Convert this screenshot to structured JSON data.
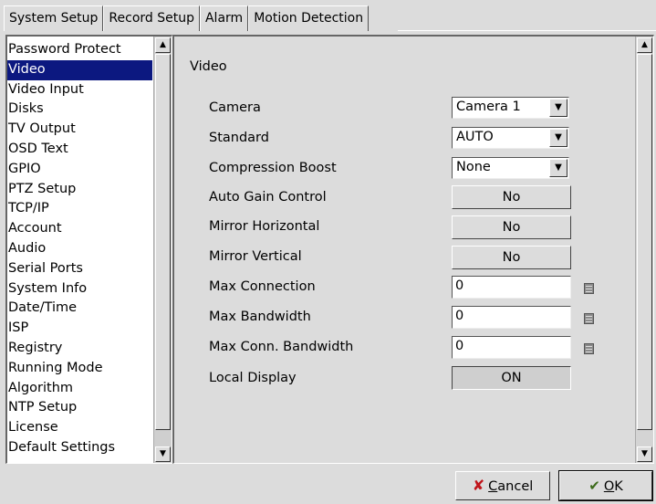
{
  "tabs": [
    "System Setup",
    "Record Setup",
    "Alarm",
    "Motion Detection"
  ],
  "sidebar": {
    "items": [
      "Password Protect",
      "Video",
      "Video Input",
      "Disks",
      "TV Output",
      "OSD Text",
      "GPIO",
      "PTZ Setup",
      "TCP/IP",
      "Account",
      "Audio",
      "Serial Ports",
      "System Info",
      "Date/Time",
      "ISP",
      "Registry",
      "Running Mode",
      "Algorithm",
      "NTP Setup",
      "License",
      "Default Settings"
    ],
    "selected": "Video"
  },
  "panel": {
    "title": "Video",
    "camera": {
      "label": "Camera",
      "value": "Camera 1"
    },
    "standard": {
      "label": "Standard",
      "value": "AUTO"
    },
    "compression_boost": {
      "label": "Compression Boost",
      "value": "None"
    },
    "auto_gain": {
      "label": "Auto Gain Control",
      "value": "No"
    },
    "mirror_h": {
      "label": "Mirror Horizontal",
      "value": "No"
    },
    "mirror_v": {
      "label": "Mirror Vertical",
      "value": "No"
    },
    "max_connection": {
      "label": "Max Connection",
      "value": "0"
    },
    "max_bandwidth": {
      "label": "Max Bandwidth",
      "value": "0"
    },
    "max_conn_bandwidth": {
      "label": "Max Conn. Bandwidth",
      "value": "0"
    },
    "local_display": {
      "label": "Local Display",
      "value": "ON"
    }
  },
  "footer": {
    "cancel_prefix": "",
    "cancel_mnemonic": "C",
    "cancel_rest": "ancel",
    "ok_mnemonic": "O",
    "ok_rest": "K"
  },
  "colors": {
    "selection": "#0c1880",
    "cancel_icon": "#c0151b",
    "ok_icon": "#3c6a1a"
  },
  "icons": [
    "scroll-up-icon",
    "scroll-down-icon",
    "dropdown-arrow-icon",
    "calculator-icon",
    "cancel-x-icon",
    "ok-check-icon"
  ]
}
